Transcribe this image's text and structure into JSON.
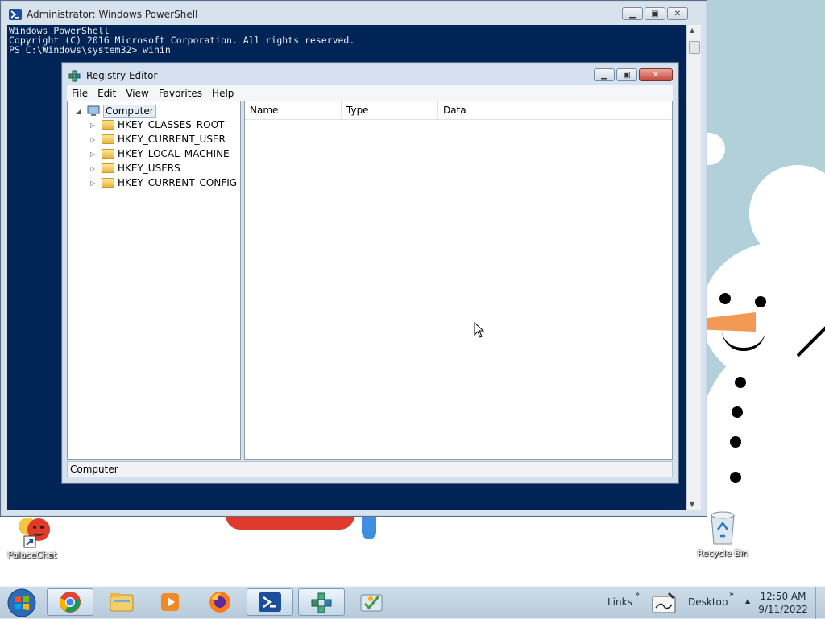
{
  "desktop": {
    "icons": [
      {
        "label": "PalaceChat"
      },
      {
        "label": "Recycle Bin"
      }
    ]
  },
  "powershell": {
    "title": "Administrator: Windows PowerShell",
    "console_lines": [
      "Windows PowerShell",
      "Copyright (C) 2016 Microsoft Corporation. All rights reserved.",
      "",
      "PS C:\\Windows\\system32> winin"
    ]
  },
  "regedit": {
    "title": "Registry Editor",
    "menu": [
      "File",
      "Edit",
      "View",
      "Favorites",
      "Help"
    ],
    "tree_root": "Computer",
    "tree_items": [
      "HKEY_CLASSES_ROOT",
      "HKEY_CURRENT_USER",
      "HKEY_LOCAL_MACHINE",
      "HKEY_USERS",
      "HKEY_CURRENT_CONFIG"
    ],
    "columns": [
      "Name",
      "Type",
      "Data"
    ],
    "status": "Computer"
  },
  "taskbar": {
    "links_label": "Links",
    "desktop_label": "Desktop",
    "clock_time": "12:50 AM",
    "clock_date": "9/11/2022"
  },
  "colors": {
    "console_bg": "#012456",
    "console_fg": "#eeedf0",
    "desktop_bg": "#b2d0da"
  }
}
